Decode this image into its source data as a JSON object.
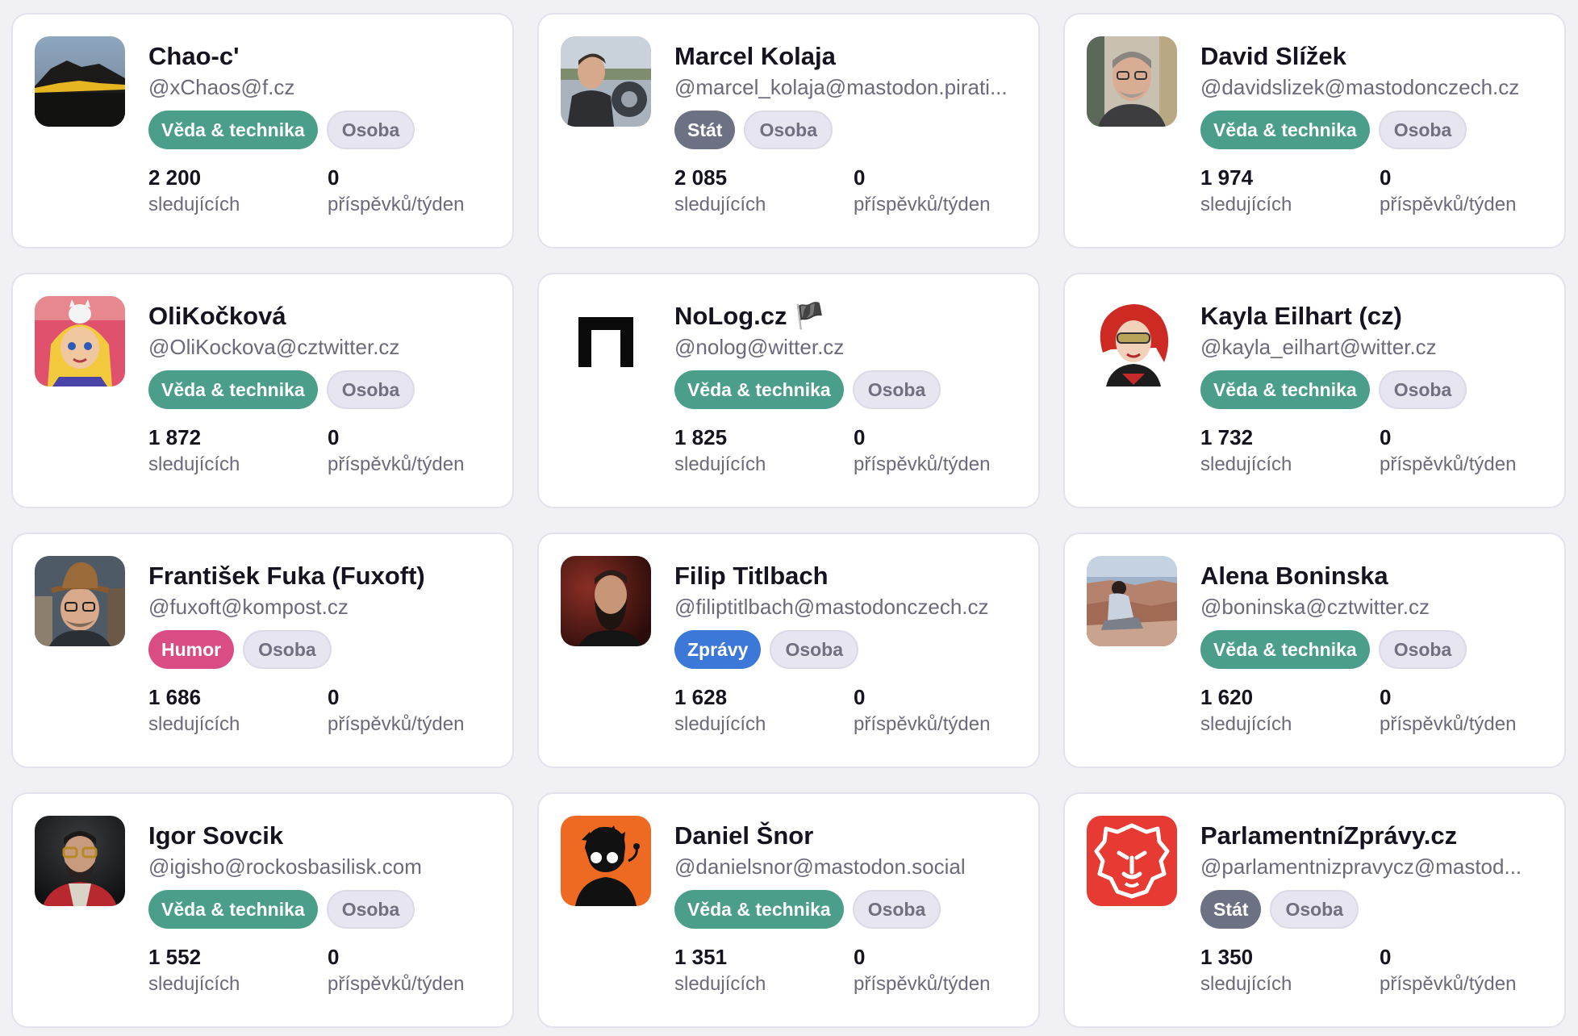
{
  "colors": {
    "veda": "#4b9e8a",
    "stat": "#6c7183",
    "humor": "#d94d84",
    "zpravy": "#3b78d8",
    "type_tag_bg": "#e7e5f0"
  },
  "labels": {
    "followers": "sledujících",
    "posts": "příspěvků/týden"
  },
  "cards": [
    {
      "name": "Chao-c'",
      "handle": "@xChaos@f.cz",
      "category": "Věda & technika",
      "category_color": "#4b9e8a",
      "type": "Osoba",
      "followers": "2 200",
      "posts": "0",
      "avatar": "landscape-sunset-avatar"
    },
    {
      "name": "Marcel Kolaja",
      "handle": "@marcel_kolaja@mastodon.pirati...",
      "category": "Stát",
      "category_color": "#6c7183",
      "type": "Osoba",
      "followers": "2 085",
      "posts": "0",
      "avatar": "man-motorcycle-avatar"
    },
    {
      "name": "David Slížek",
      "handle": "@davidslizek@mastodonczech.cz",
      "category": "Věda & technika",
      "category_color": "#4b9e8a",
      "type": "Osoba",
      "followers": "1 974",
      "posts": "0",
      "avatar": "man-glasses-avatar"
    },
    {
      "name": "OliKočková",
      "handle": "@OliKockova@cztwitter.cz",
      "category": "Věda & technika",
      "category_color": "#4b9e8a",
      "type": "Osoba",
      "followers": "1 872",
      "posts": "0",
      "avatar": "girl-cat-illustration-avatar"
    },
    {
      "name": "NoLog.cz 🏴",
      "handle": "@nolog@witter.cz",
      "category": "Věda & technika",
      "category_color": "#4b9e8a",
      "type": "Osoba",
      "followers": "1 825",
      "posts": "0",
      "avatar": "nolog-logo-avatar"
    },
    {
      "name": "Kayla Eilhart (cz)",
      "handle": "@kayla_eilhart@witter.cz",
      "category": "Věda & technika",
      "category_color": "#4b9e8a",
      "type": "Osoba",
      "followers": "1 732",
      "posts": "0",
      "avatar": "red-hair-cartoon-avatar"
    },
    {
      "name": "František Fuka (Fuxoft)",
      "handle": "@fuxoft@kompost.cz",
      "category": "Humor",
      "category_color": "#d94d84",
      "type": "Osoba",
      "followers": "1 686",
      "posts": "0",
      "avatar": "man-hat-avatar"
    },
    {
      "name": "Filip Titlbach",
      "handle": "@filiptitlbach@mastodonczech.cz",
      "category": "Zprávy",
      "category_color": "#3b78d8",
      "type": "Osoba",
      "followers": "1 628",
      "posts": "0",
      "avatar": "bearded-man-avatar"
    },
    {
      "name": "Alena Boninska",
      "handle": "@boninska@cztwitter.cz",
      "category": "Věda & technika",
      "category_color": "#4b9e8a",
      "type": "Osoba",
      "followers": "1 620",
      "posts": "0",
      "avatar": "woman-canyon-avatar"
    },
    {
      "name": "Igor Sovcik",
      "handle": "@igisho@rockosbasilisk.com",
      "category": "Věda & technika",
      "category_color": "#4b9e8a",
      "type": "Osoba",
      "followers": "1 552",
      "posts": "0",
      "avatar": "man-hoodie-avatar"
    },
    {
      "name": "Daniel Šnor",
      "handle": "@danielsnor@mastodon.social",
      "category": "Věda & technika",
      "category_color": "#4b9e8a",
      "type": "Osoba",
      "followers": "1 351",
      "posts": "0",
      "avatar": "orange-silhouette-avatar"
    },
    {
      "name": "ParlamentníZprávy.cz",
      "handle": "@parlamentnizpravycz@mastod...",
      "category": "Stát",
      "category_color": "#6c7183",
      "type": "Osoba",
      "followers": "1 350",
      "posts": "0",
      "avatar": "lion-logo-avatar"
    }
  ]
}
